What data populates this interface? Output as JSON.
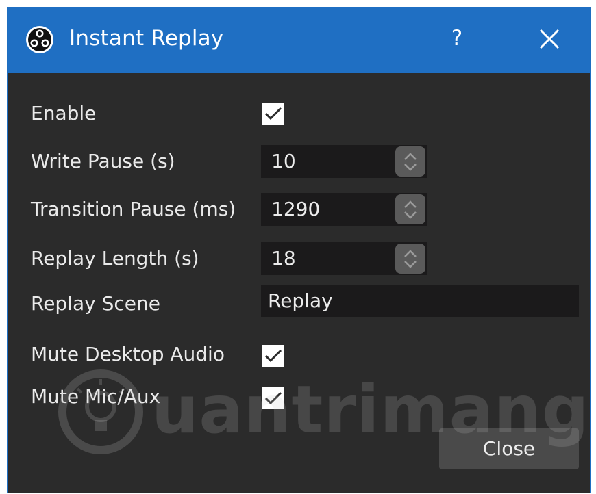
{
  "window": {
    "title": "Instant Replay",
    "help_label": "?",
    "close_icon": "close-icon",
    "logo_icon": "obs-logo-icon",
    "accent_color": "#1f6fc3",
    "background_color": "#2b2b2b"
  },
  "form": {
    "enable": {
      "label": "Enable",
      "checked": true
    },
    "write_pause": {
      "label": "Write Pause (s)",
      "value": "10"
    },
    "transition_pause": {
      "label": "Transition Pause (ms)",
      "value": "1290"
    },
    "replay_length": {
      "label": "Replay Length (s)",
      "value": "18"
    },
    "replay_scene": {
      "label": "Replay Scene",
      "value": "Replay"
    },
    "mute_desktop_audio": {
      "label": "Mute Desktop Audio",
      "checked": true
    },
    "mute_mic_aux": {
      "label": "Mute Mic/Aux",
      "checked": true
    }
  },
  "footer": {
    "close_label": "Close"
  },
  "watermark": {
    "text": "uantrimang",
    "icon": "lightbulb-icon"
  }
}
